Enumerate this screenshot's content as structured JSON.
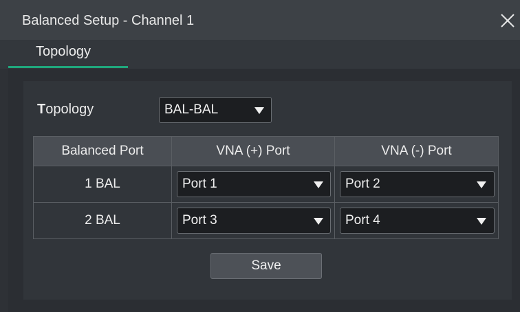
{
  "dialog": {
    "title": "Balanced Setup - Channel 1",
    "close_icon": "close-icon"
  },
  "tabs": [
    {
      "label": "Topology",
      "active": true
    }
  ],
  "topology": {
    "label_first": "T",
    "label_rest": "opology",
    "selected": "BAL-BAL"
  },
  "table": {
    "headers": [
      "Balanced Port",
      "VNA (+) Port",
      "VNA (-) Port"
    ],
    "rows": [
      {
        "port": "1 BAL",
        "plus": "Port 1",
        "minus": "Port 2"
      },
      {
        "port": "2 BAL",
        "plus": "Port 3",
        "minus": "Port 4"
      }
    ]
  },
  "buttons": {
    "save": "Save"
  },
  "colors": {
    "accent": "#1fa77c",
    "titlebar": "#3d4146",
    "panel": "#31353a",
    "header_cell": "#4a4e54"
  }
}
